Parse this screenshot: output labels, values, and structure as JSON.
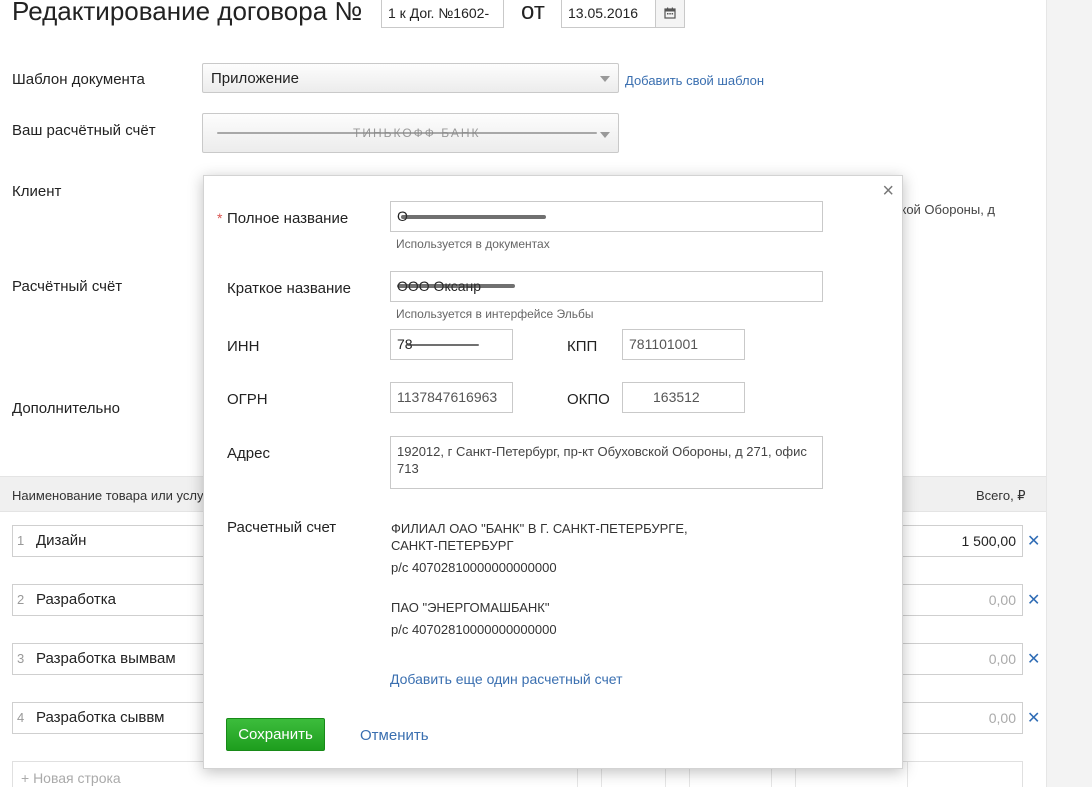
{
  "header": {
    "title": "Редактирование договора №",
    "contract_number": "1 к Дог. №1602-",
    "from_label": "от",
    "date": "13.05.2016"
  },
  "form": {
    "template_label": "Шаблон документа",
    "template_value": "Приложение",
    "add_template_link": "Добавить свой шаблон",
    "account_label": "Ваш расчётный счёт",
    "account_value": "ТИНЬКОФФ БАНК",
    "client_label": "Клиент",
    "client_address_fragment": "овской Обороны, д",
    "client_account_label": "Расчётный счёт",
    "extra_label": "Дополнительно"
  },
  "table": {
    "col_name": "Наименование товара или услу",
    "col_total": "Всего, ₽",
    "rows": [
      {
        "num": "1",
        "name": "Дизайн",
        "total": "1 500,00"
      },
      {
        "num": "2",
        "name": "Разработка",
        "total": "0,00"
      },
      {
        "num": "3",
        "name": "Разработка вымвам",
        "total": "0,00"
      },
      {
        "num": "4",
        "name": "Разработка сыввм",
        "total": "0,00"
      }
    ],
    "delete_symbol": "✕",
    "new_row_label": "+ Новая строка"
  },
  "modal": {
    "close_symbol": "×",
    "required_mark": "*",
    "full_name_label": "Полное название",
    "full_name_value": "О",
    "full_name_hint": "Используется в документах",
    "short_name_label": "Краткое название",
    "short_name_value": "ООО Оксанр",
    "short_name_hint": "Используется в интерфейсе Эльбы",
    "inn_label": "ИНН",
    "inn_value": "78",
    "kpp_label": "КПП",
    "kpp_value": "781101001",
    "ogrn_label": "ОГРН",
    "ogrn_value": "1137847616963",
    "okpo_label": "ОКПО",
    "okpo_value": "163512",
    "address_label": "Адрес",
    "address_value": "192012, г Санкт-Петербург, пр-кт Обуховской Обороны, д 271, офис 713",
    "account_label": "Расчетный счет",
    "account_line1": "ФИЛИАЛ ОАО \"БАНК\" В Г. САНКТ-ПЕТЕРБУРГЕ,",
    "account_line2": "САНКТ-ПЕТЕРБУРГ",
    "account_line3": "р/с 40702810000000000000",
    "account_line4": "ПАО \"ЭНЕРГОМАШБАНК\"",
    "account_line5": "р/с 40702810000000000000",
    "add_account_link": "Добавить еще один расчетный счет",
    "save_label": "Сохранить",
    "cancel_label": "Отменить"
  }
}
